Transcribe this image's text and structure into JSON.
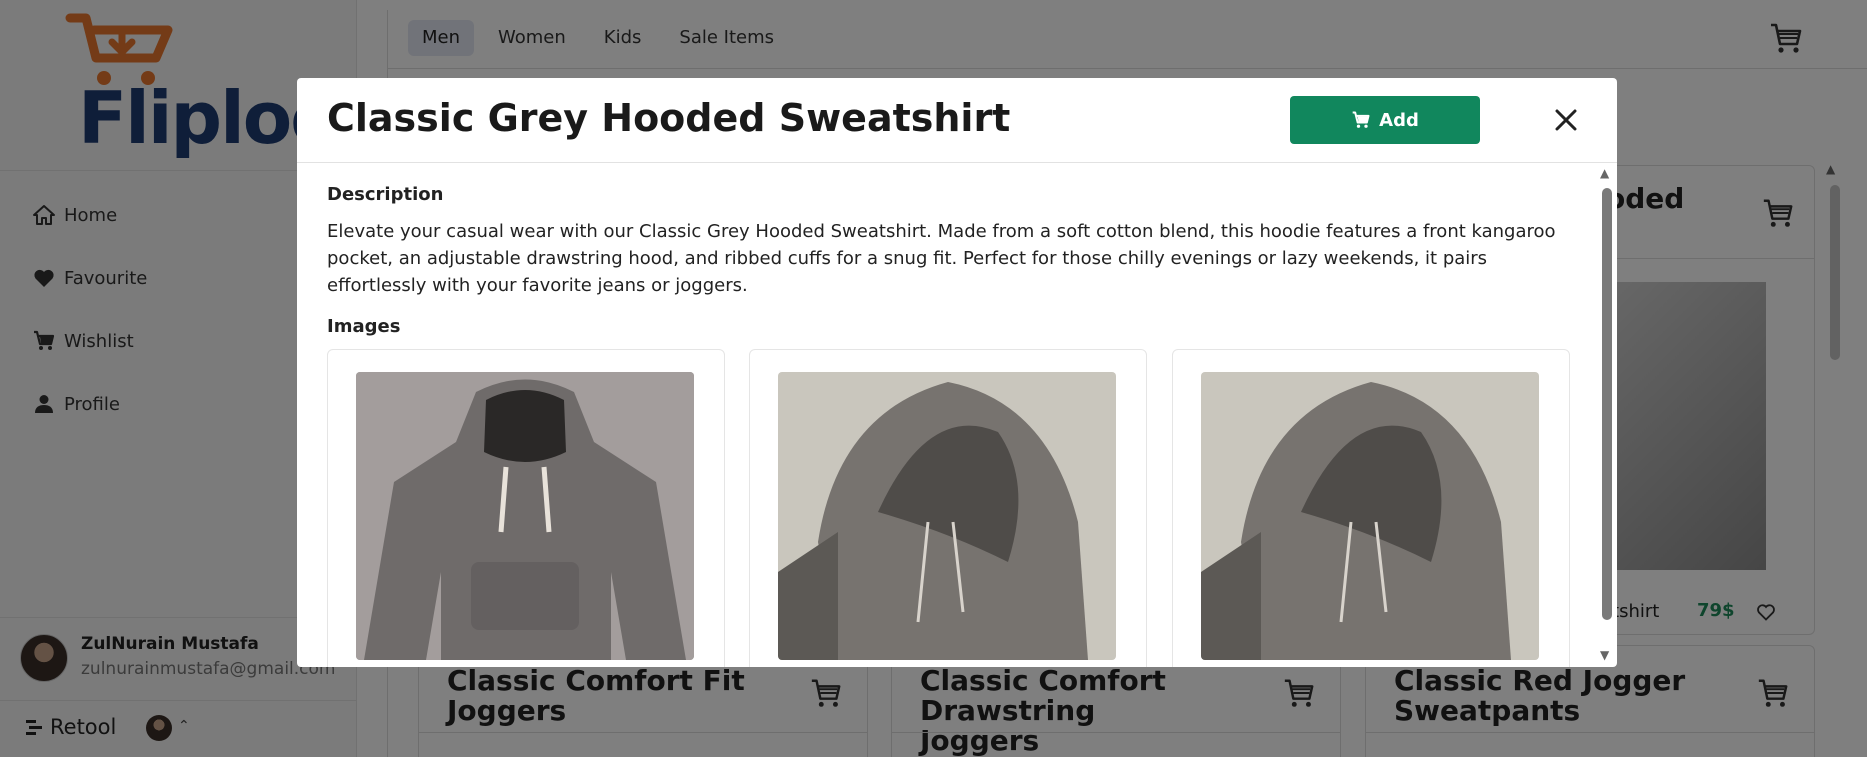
{
  "brand": {
    "logo_text": "Fliploo",
    "accent": "#e8772e",
    "navy": "#1f3d73"
  },
  "sidebar": {
    "items": [
      {
        "label": "Home",
        "icon": "home-icon"
      },
      {
        "label": "Favourite",
        "icon": "heart-icon"
      },
      {
        "label": "Wishlist",
        "icon": "cart-icon"
      },
      {
        "label": "Profile",
        "icon": "user-icon"
      }
    ],
    "user": {
      "name": "ZulNurain Mustafa",
      "email": "zulnurainmustafa@gmail.com"
    },
    "footer": {
      "brand": "Retool"
    }
  },
  "tabs": [
    "Men",
    "Women",
    "Kids",
    "Sale Items"
  ],
  "active_tab": "Men",
  "background_cards": {
    "top_right": {
      "title_fragment": "oded",
      "name_fragment": "atshirt",
      "price": "79$"
    },
    "row2": [
      {
        "title": "Classic Comfort Fit Joggers"
      },
      {
        "title": "Classic Comfort Drawstring Joggers"
      },
      {
        "title": "Classic Red Jogger Sweatpants"
      }
    ]
  },
  "modal": {
    "title": "Classic Grey Hooded Sweatshirt",
    "add_label": "Add",
    "description_label": "Description",
    "description": "Elevate your casual wear with our Classic Grey Hooded Sweatshirt. Made from a soft cotton blend, this hoodie features a front kangaroo pocket, an adjustable drawstring hood, and ribbed cuffs for a snug fit. Perfect for those chilly evenings or lazy weekends, it pairs effortlessly with your favorite jeans or joggers.",
    "images_label": "Images",
    "button_color": "#11875d"
  }
}
